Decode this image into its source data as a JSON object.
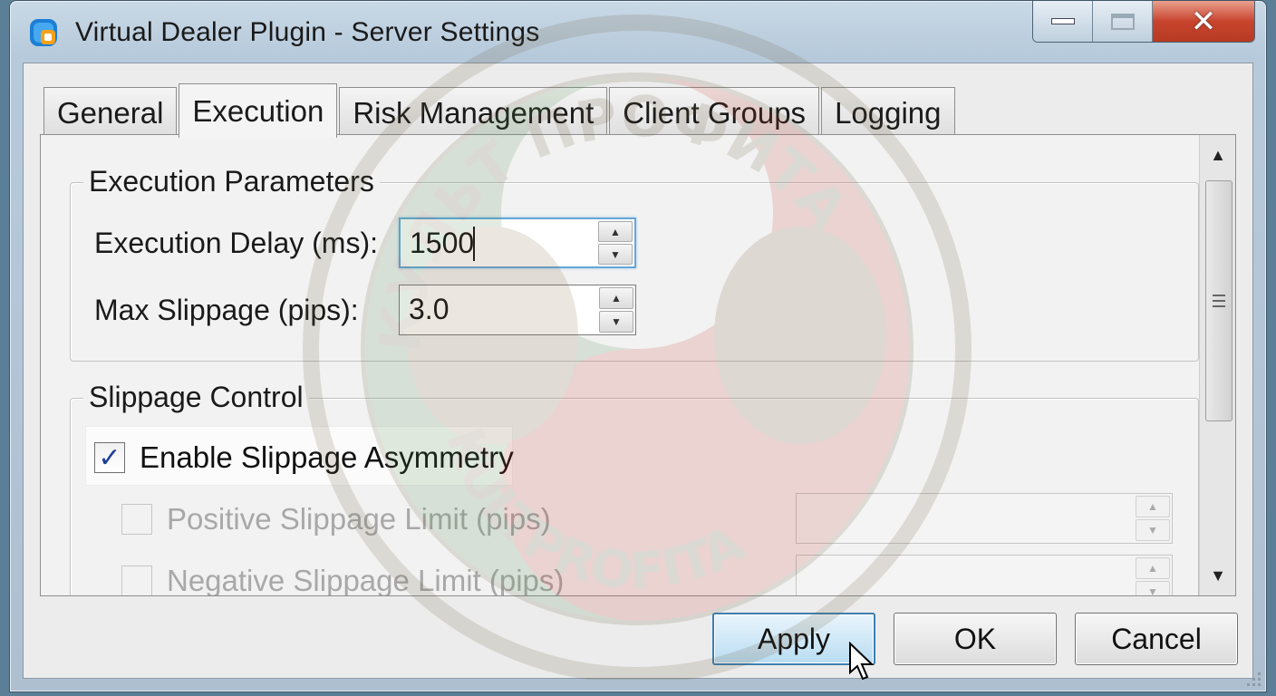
{
  "window": {
    "title": "Virtual Dealer Plugin - Server Settings",
    "caption_buttons": [
      "minimize",
      "maximize",
      "close"
    ]
  },
  "tabs": [
    {
      "label": "General",
      "active": false
    },
    {
      "label": "Execution",
      "active": true
    },
    {
      "label": "Risk Management",
      "active": false
    },
    {
      "label": "Client Groups",
      "active": false
    },
    {
      "label": "Logging",
      "active": false
    }
  ],
  "execution_parameters": {
    "title": "Execution Parameters",
    "delay_label": "Execution Delay (ms):",
    "delay_value": "1500",
    "slippage_label": "Max Slippage (pips):",
    "slippage_value": "3.0"
  },
  "slippage_control": {
    "title": "Slippage Control",
    "asymmetry_label": "Enable Slippage Asymmetry",
    "asymmetry_checked": true,
    "positive_label": "Positive Slippage Limit (pips)",
    "positive_value": "",
    "negative_label": "Negative Slippage Limit (pips)",
    "negative_value": ""
  },
  "buttons": {
    "apply": "Apply",
    "ok": "OK",
    "cancel": "Cancel"
  },
  "watermark": {
    "text_top": "КУЛЬТ ПРОФИТА",
    "text_bottom": "KULTPROFITA"
  },
  "colors": {
    "accent": "#3c7fb1",
    "close_button": "#c8442d",
    "check_mark": "#1d3f9a"
  }
}
